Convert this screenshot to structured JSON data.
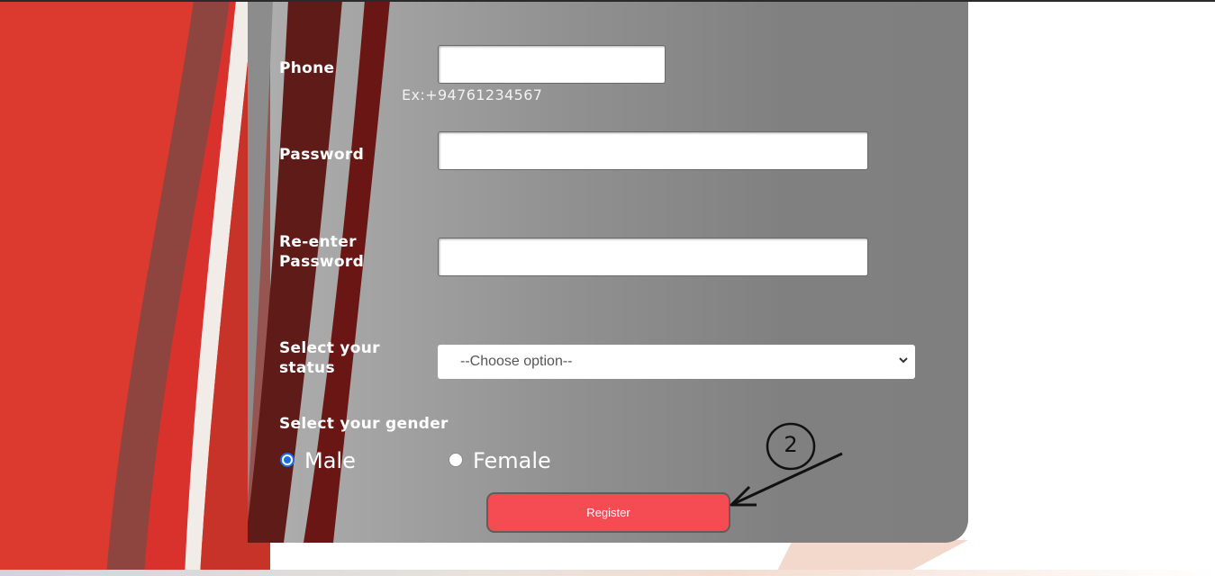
{
  "form": {
    "phone": {
      "label": "Phone",
      "value": "",
      "hint": "Ex:+94761234567"
    },
    "password": {
      "label": "Password",
      "value": ""
    },
    "reenter_password": {
      "label": "Re-enter\nPassword",
      "value": ""
    },
    "status": {
      "label": "Select your\nstatus",
      "selected": "--Choose option--"
    },
    "gender": {
      "label": "Select your gender",
      "options": [
        {
          "label": "Male",
          "checked": true
        },
        {
          "label": "Female",
          "checked": false
        }
      ]
    },
    "register_label": "Register"
  },
  "annotation": {
    "number": "2"
  },
  "colors": {
    "accent_red": "#f44c52",
    "background_red": "#d9312b",
    "panel_gray": "#808080",
    "radio_blue": "#1a6fe0"
  },
  "icons": {
    "select_arrow": "chevron-down-icon",
    "annotation_arrow": "arrow-icon"
  }
}
